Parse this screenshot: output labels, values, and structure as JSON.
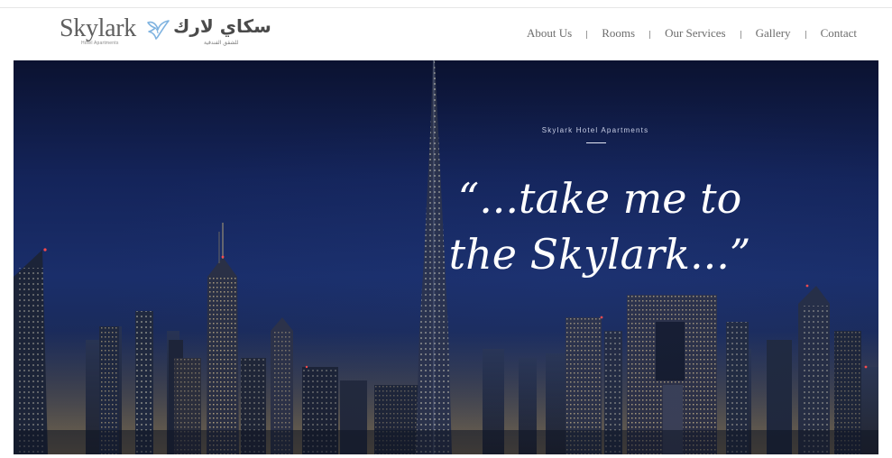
{
  "header": {
    "logo": {
      "latin_name": "Skylark",
      "latin_sub": "Hotel Apartments",
      "arabic_name": "سكاي لارك",
      "arabic_sub": "للشقق الفندقية"
    },
    "nav": [
      {
        "label": "About Us"
      },
      {
        "label": "Rooms"
      },
      {
        "label": "Our Services"
      },
      {
        "label": "Gallery"
      },
      {
        "label": "Contact"
      }
    ]
  },
  "hero": {
    "eyebrow": "Skylark Hotel Apartments",
    "quote_line_1": "“...take me to",
    "quote_line_2": "the Skylark...”"
  },
  "colors": {
    "nav_text": "#6d6d6d",
    "hero_sky": "#14245a",
    "quote_text": "#ffffff",
    "logo_bird": "#7fb3e0"
  }
}
